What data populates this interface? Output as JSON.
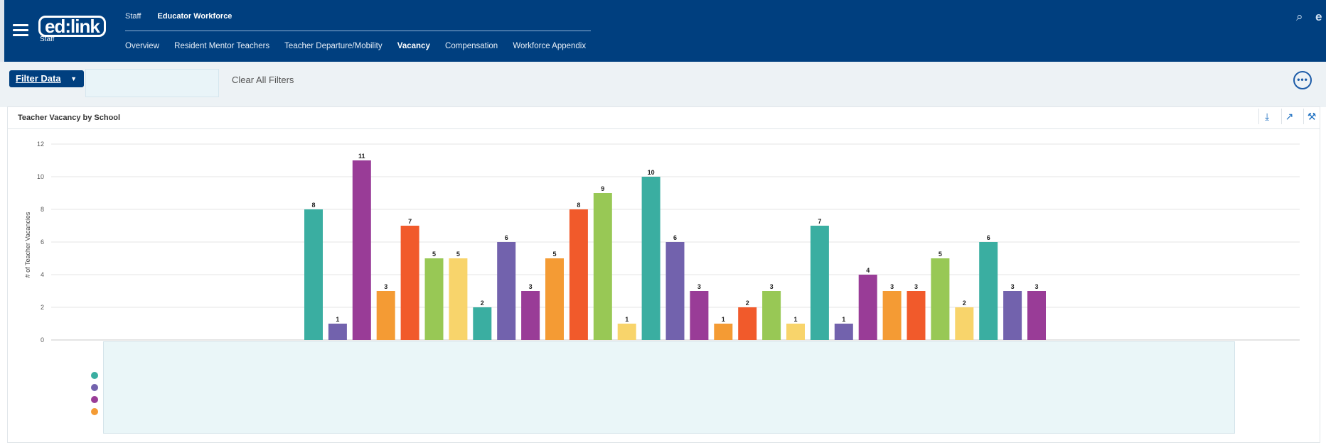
{
  "header": {
    "logo_text": "ed:link",
    "logo_sub": "Staff",
    "nav_top": [
      "Staff",
      "Educator Workforce"
    ],
    "nav_sub": [
      "Overview",
      "Resident Mentor Teachers",
      "Teacher Departure/Mobility",
      "Vacancy",
      "Compensation",
      "Workforce Appendix"
    ],
    "active_sub": "Vacancy"
  },
  "filters": {
    "filter_label": "Filter Data",
    "clear_label": "Clear All Filters",
    "more_label": "•••"
  },
  "panel": {
    "title": "Teacher Vacancy by School",
    "tools": [
      "download-icon",
      "export-icon",
      "settings-icon"
    ]
  },
  "colors": {
    "teal": "#3aaea1",
    "purple": "#7262ad",
    "magenta": "#993c97",
    "orange": "#f49b34",
    "red": "#f15a2b",
    "green": "#98c855",
    "yellow": "#f8d46b",
    "header": "#003f7f"
  },
  "chart_data": {
    "type": "bar",
    "title": "Teacher Vacancy by School",
    "ylabel": "# of Teacher Vacancies",
    "xlabel": "",
    "ylim": [
      0,
      12
    ],
    "yticks": [
      0,
      2,
      4,
      6,
      8,
      10,
      12
    ],
    "grid": true,
    "values": [
      8,
      1,
      11,
      3,
      7,
      5,
      5,
      2,
      6,
      3,
      5,
      8,
      9,
      1,
      10,
      6,
      3,
      1,
      2,
      3,
      1,
      7,
      1,
      4,
      3,
      3,
      5,
      2,
      6,
      3,
      3
    ],
    "colors": [
      "#3aaea1",
      "#7262ad",
      "#993c97",
      "#f49b34",
      "#f15a2b",
      "#98c855",
      "#f8d46b",
      "#3aaea1",
      "#7262ad",
      "#993c97",
      "#f49b34",
      "#f15a2b",
      "#98c855",
      "#f8d46b",
      "#3aaea1",
      "#7262ad",
      "#993c97",
      "#f49b34",
      "#f15a2b",
      "#98c855",
      "#f8d46b",
      "#3aaea1",
      "#7262ad",
      "#993c97",
      "#f49b34",
      "#f15a2b",
      "#98c855",
      "#f8d46b",
      "#3aaea1",
      "#7262ad",
      "#993c97"
    ],
    "legend_colors": [
      "#3aaea1",
      "#7262ad",
      "#993c97",
      "#f49b34"
    ]
  }
}
